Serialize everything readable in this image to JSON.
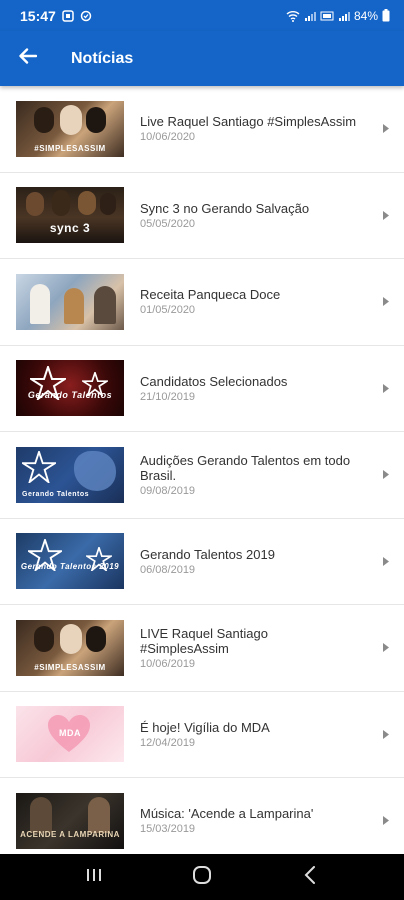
{
  "status_bar": {
    "time": "15:47",
    "battery": "84%"
  },
  "app_bar": {
    "title": "Notícias"
  },
  "news": [
    {
      "title": "Live Raquel Santiago #SimplesAssim",
      "date": "10/06/2020",
      "thumb_caption": "#SIMPLESASSIM"
    },
    {
      "title": "Sync 3 no Gerando Salvação",
      "date": "05/05/2020",
      "thumb_caption": "sync 3"
    },
    {
      "title": "Receita Panqueca Doce",
      "date": "01/05/2020",
      "thumb_caption": ""
    },
    {
      "title": "Candidatos Selecionados",
      "date": "21/10/2019",
      "thumb_caption": "Gerando Talentos"
    },
    {
      "title": "Audições Gerando Talentos em todo Brasil.",
      "date": "09/08/2019",
      "thumb_caption": "Gerando Talentos"
    },
    {
      "title": "Gerando Talentos 2019",
      "date": "06/08/2019",
      "thumb_caption": "Gerando Talentos 2019"
    },
    {
      "title": "LIVE  Raquel Santiago #SimplesAssim",
      "date": "10/06/2019",
      "thumb_caption": "#SIMPLESASSIM"
    },
    {
      "title": "É hoje! Vigília do MDA",
      "date": "12/04/2019",
      "thumb_caption": "MDA"
    },
    {
      "title": "Música:  'Acende a Lamparina'",
      "date": "15/03/2019",
      "thumb_caption": "ACENDE A LAMPARINA"
    }
  ],
  "colors": {
    "primary": "#1565c8",
    "title_text": "#333333",
    "date_text": "#999999"
  }
}
